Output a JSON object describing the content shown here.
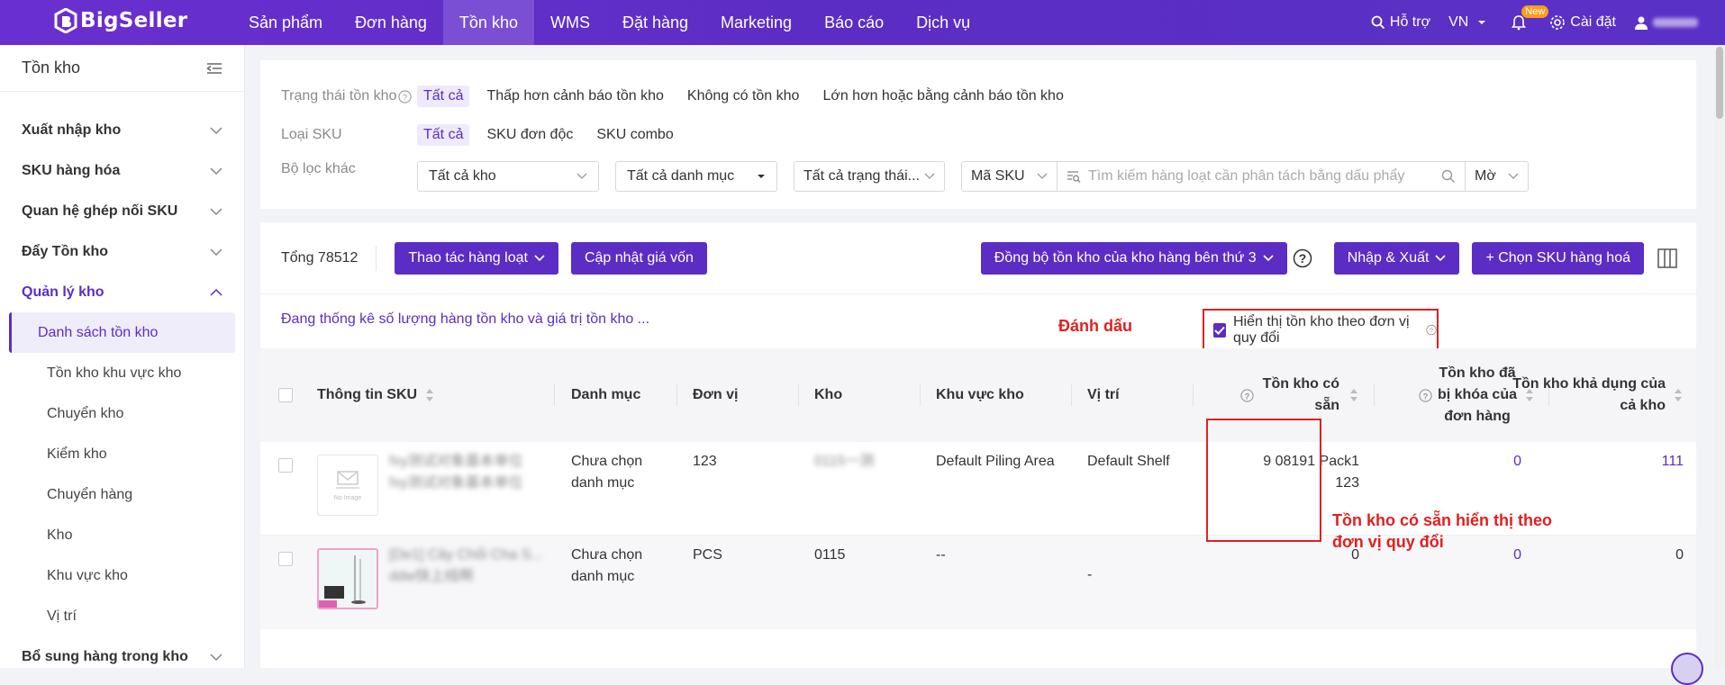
{
  "topbar": {
    "logo": "BigSeller",
    "nav": [
      "Sản phẩm",
      "Đơn hàng",
      "Tồn kho",
      "WMS",
      "Đặt hàng",
      "Marketing",
      "Báo cáo",
      "Dịch vụ"
    ],
    "active_nav": "Tồn kho",
    "support": "Hỗ trợ",
    "lang": "VN",
    "new_badge": "New",
    "settings": "Cài đặt"
  },
  "sidebar": {
    "title": "Tồn kho",
    "groups": [
      {
        "label": "Xuất nhập kho",
        "expanded": false
      },
      {
        "label": "SKU hàng hóa",
        "expanded": false
      },
      {
        "label": "Quan hệ ghép nối SKU",
        "expanded": false
      },
      {
        "label": "Đẩy Tồn kho",
        "expanded": false
      },
      {
        "label": "Quản lý kho",
        "expanded": true
      }
    ],
    "items": [
      "Danh sách tồn kho",
      "Tồn kho khu vực kho",
      "Chuyển kho",
      "Kiểm kho",
      "Chuyển hàng",
      "Kho",
      "Khu vực kho",
      "Vị trí"
    ],
    "last_group": "Bổ sung hàng trong kho"
  },
  "filters": {
    "status_label": "Trạng thái tồn kho",
    "status_options": [
      "Tất cả",
      "Thấp hơn cảnh báo tồn kho",
      "Không có tồn kho",
      "Lớn hơn hoặc bằng cảnh báo tồn kho"
    ],
    "sku_type_label": "Loại SKU",
    "sku_type_options": [
      "Tất cả",
      "SKU đơn độc",
      "SKU combo"
    ],
    "other_label": "Bộ lọc khác",
    "warehouse_select": "Tất cả kho",
    "category_select": "Tất cả danh mục",
    "status_select": "Tất cả trạng thái...",
    "sku_field_select": "Mã SKU",
    "search_placeholder": "Tìm kiếm hàng loạt cần phân tách bằng dấu phẩy",
    "match_select": "Mờ"
  },
  "toolbar": {
    "total": "Tổng 78512",
    "bulk_action": "Thao tác hàng loạt",
    "update_cost": "Cập nhật giá vốn",
    "sync_third_party": "Đồng bộ tồn kho của kho hàng bên thứ 3",
    "import_export": "Nhập & Xuất",
    "choose_sku": "+ Chọn SKU hàng hoá"
  },
  "stat_line": "Đang thống kê số lượng hàng tồn kho và giá trị tồn kho ...",
  "annotations": {
    "mark": "Đánh dấu",
    "note_line1": "Tồn kho có sẵn hiển thị theo",
    "note_line2": "đơn vị quy đổi"
  },
  "convert_toggle": "Hiển thị tồn kho theo đơn vị quy đổi",
  "table": {
    "columns": {
      "sku_info": "Thông tin SKU",
      "category": "Danh mục",
      "unit": "Đơn vị",
      "warehouse": "Kho",
      "zone": "Khu vực kho",
      "location": "Vị trí",
      "available_l1": "Tồn kho có",
      "available_l2": "sẵn",
      "locked_l1": "Tồn kho đã",
      "locked_l2": "bị khóa của",
      "locked_l3": "đơn hàng",
      "usable_l1": "Tồn kho khả dụng của",
      "usable_l2": "cả kho"
    },
    "rows": [
      {
        "sku_l1": "fxy测试对象基本单位",
        "sku_l2": "fxy测试对象基本单位",
        "no_image": "No Image",
        "category_l1": "Chưa chọn",
        "category_l2": "danh mục",
        "unit": "123",
        "warehouse": "0115一测",
        "zone": "Default Piling Area",
        "location": "Default Shelf",
        "available_l1": "9 08191 Pack1",
        "available_l2": "123",
        "locked": "0",
        "usable": "111"
      },
      {
        "sku_l1": "[De1] Cây Chổi Cha S...",
        "sku_l2": "ddw快上线啊",
        "category_l1": "Chưa chọn",
        "category_l2": "danh mục",
        "unit": "PCS",
        "warehouse": "0115",
        "zone": "--",
        "location": "-",
        "available": "0",
        "locked": "0",
        "usable": "0"
      }
    ]
  },
  "colors": {
    "brand": "#5b2dc4",
    "annotation": "#e02020"
  }
}
